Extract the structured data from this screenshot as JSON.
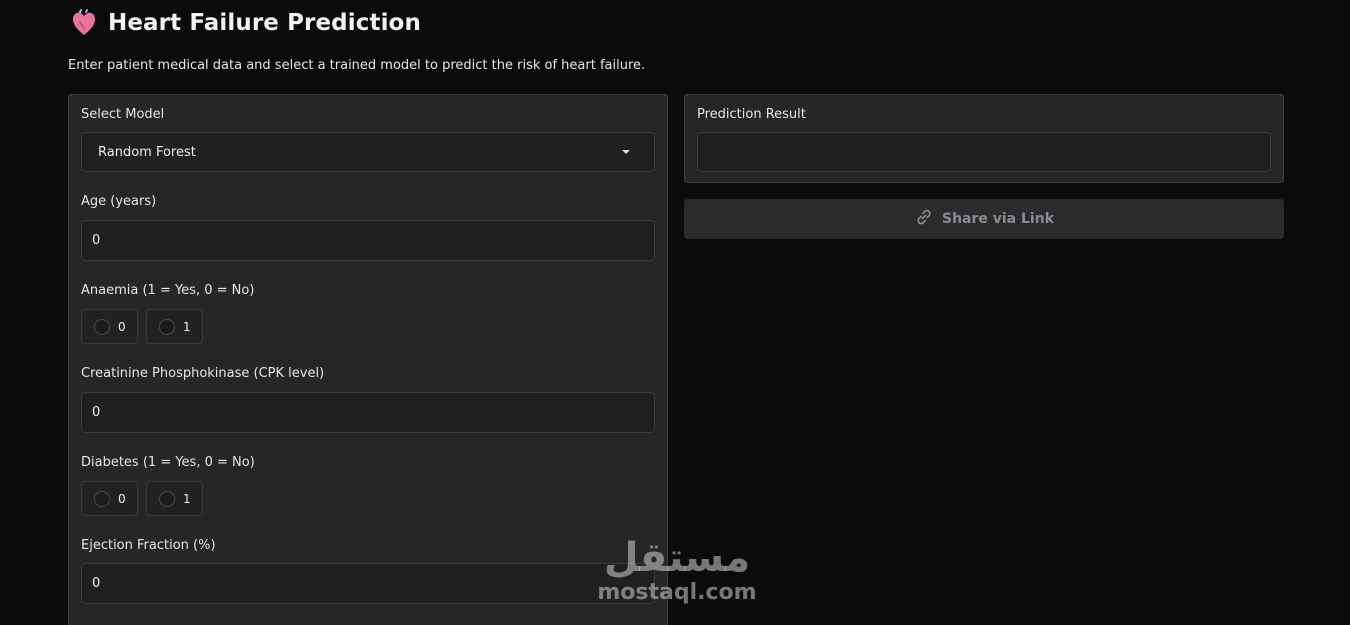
{
  "header": {
    "title": "Heart Failure Prediction",
    "subtitle": "Enter patient medical data and select a trained model to predict the risk of heart failure.",
    "icon": "anatomical-heart-icon"
  },
  "form": {
    "model": {
      "label": "Select Model",
      "value": "Random Forest"
    },
    "age": {
      "label": "Age (years)",
      "value": "0"
    },
    "anaemia": {
      "label": "Anaemia (1 = Yes, 0 = No)",
      "options": [
        "0",
        "1"
      ]
    },
    "cpk": {
      "label": "Creatinine Phosphokinase (CPK level)",
      "value": "0"
    },
    "diabetes": {
      "label": "Diabetes (1 = Yes, 0 = No)",
      "options": [
        "0",
        "1"
      ]
    },
    "ejection_fraction": {
      "label": "Ejection Fraction (%)",
      "value": "0"
    }
  },
  "result": {
    "label": "Prediction Result",
    "value": ""
  },
  "share": {
    "label": "Share via Link",
    "icon": "link-icon"
  },
  "watermark": {
    "arabic": "مستقل",
    "latin": "mostaql.com"
  },
  "colors": {
    "background": "#0b0b0c",
    "panel": "#262628",
    "input": "#202022",
    "border": "#3b3b3e",
    "share_text": "#8b8b90",
    "heart": "#e8739a"
  }
}
